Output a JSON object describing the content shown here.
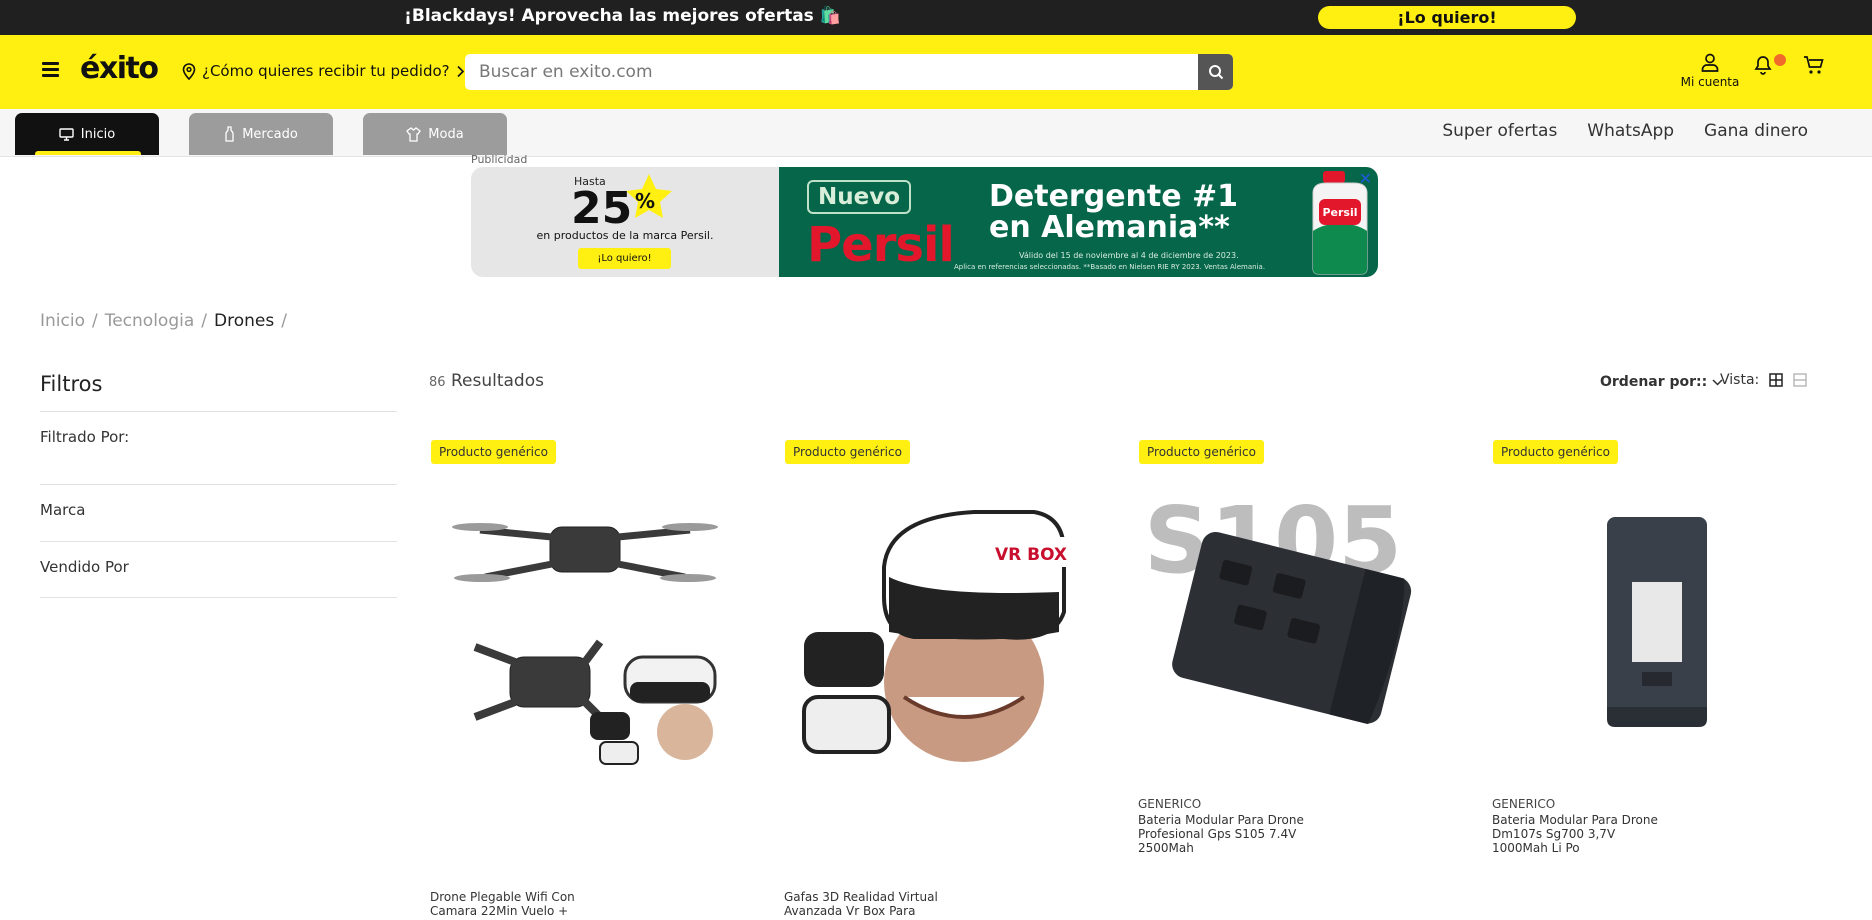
{
  "topbar": {
    "promo_text": "¡Blackdays! Aprovecha las mejores ofertas 🛍️",
    "cta_label": "¡Lo quiero!"
  },
  "header": {
    "logo_text": "éxito",
    "delivery_text": "¿Cómo quieres recibir tu pedido?",
    "search_placeholder": "Buscar en exito.com",
    "account_label": "Mi cuenta"
  },
  "nav": {
    "tabs": [
      {
        "label": "Inicio",
        "icon": "monitor-icon",
        "active": true
      },
      {
        "label": "Mercado",
        "icon": "bottle-icon",
        "active": false
      },
      {
        "label": "Moda",
        "icon": "shirt-icon",
        "active": false
      }
    ],
    "links": [
      "Super ofertas",
      "WhatsApp",
      "Gana dinero"
    ]
  },
  "ad": {
    "label": "Publicidad",
    "hasta": "Hasta",
    "percent": "25",
    "percent_sign": "%",
    "line": "en productos de la marca Persil.",
    "cta": "¡Lo quiero!",
    "nuevo": "Nuevo",
    "brand": "Persil",
    "headline_1": "Detergente #1",
    "headline_2": "en Alemania**",
    "fine_1": "Válido del 15 de noviembre al 4 de diciembre de 2023.",
    "fine_2": "Aplica en referencias seleccionadas. **Basado en Nielsen RIE RY 2023. Ventas Alemania.",
    "bottle_brand": "Persil",
    "close": "✕"
  },
  "breadcrumb": [
    "Inicio",
    "Tecnologia",
    "Drones"
  ],
  "filters": {
    "title": "Filtros",
    "filtered_by": "Filtrado Por:",
    "sections": [
      "Marca",
      "Vendido Por"
    ]
  },
  "results": {
    "count": "86",
    "label": "Resultados"
  },
  "toolbar": {
    "sort_label": "Ordenar por::",
    "view_label": "Vista:"
  },
  "products": [
    {
      "badge": "Producto genérico",
      "brand": "",
      "name": "Drone Plegable Wifi Con Camara 22Min Vuelo +",
      "image": "drone-vr-kit"
    },
    {
      "badge": "Producto genérico",
      "brand": "",
      "name": "Gafas 3D Realidad Virtual Avanzada Vr Box Para",
      "image": "vr-box",
      "image_text": "VR BOX"
    },
    {
      "badge": "Producto genérico",
      "brand": "GENERICO",
      "name": "Bateria Modular Para Drone Profesional Gps S105 7.4V 2500Mah",
      "image": "battery-s105",
      "image_text": "S105"
    },
    {
      "badge": "Producto genérico",
      "brand": "GENERICO",
      "name": "Bateria Modular Para Drone Dm107s Sg700 3,7V 1000Mah Li Po",
      "image": "battery-dm107s"
    }
  ],
  "colors": {
    "brand_yellow": "#fff012",
    "topbar": "#202020",
    "ad_green": "#06664a",
    "persil_red": "#e2172b"
  }
}
